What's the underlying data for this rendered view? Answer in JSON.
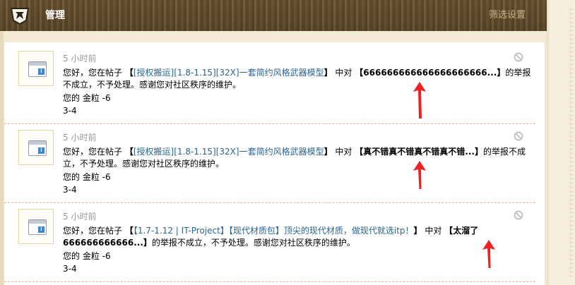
{
  "header": {
    "title": "管理",
    "filter_label": "筛选设置",
    "logo_icon": "pickaxe-shield-icon"
  },
  "notifications": [
    {
      "time": "5 小时前",
      "prefix": "您好，您在帖子",
      "bracket_open": "【",
      "thread_link": "[授权搬运][1.8-1.15][32X]一套简约风格武器模型",
      "bracket_close": "】",
      "mid": "中对",
      "reply_open": "【",
      "reply_quote": "666666666666666666666...",
      "reply_close": "】",
      "suffix": "的举报不成立，不予处理。感谢您对社区秩序的维护。",
      "reward_label": "您的 金粒",
      "reward_value": "-6",
      "score": "3-4"
    },
    {
      "time": "5 小时前",
      "prefix": "您好，您在帖子",
      "bracket_open": "【",
      "thread_link": "[授权搬运][1.8-1.15][32X]一套简约风格武器模型",
      "bracket_close": "】",
      "mid": "中对",
      "reply_open": "【",
      "reply_quote": "真不错真不错真不错真不错...",
      "reply_close": "】",
      "suffix": "的举报不成立，不予处理。感谢您对社区秩序的维护。",
      "reward_label": "您的 金粒",
      "reward_value": "-6",
      "score": "3-4"
    },
    {
      "time": "5 小时前",
      "prefix": "您好，您在帖子",
      "bracket_open": "【",
      "thread_link": "【1.7-1.12 | IT-Project】【现代材质包】顶尖的现代材质，做现代就选itp！",
      "bracket_close": "】",
      "mid": "中对",
      "reply_open": "【",
      "reply_quote": "太溜了666666666666...",
      "reply_close": "】",
      "suffix": "的举报不成立，不予处理。感谢您对社区秩序的维护。",
      "reward_label": "您的 金粒",
      "reward_value": "-6",
      "score": "3-4"
    }
  ],
  "colors": {
    "link": "#2a6496",
    "annotation_arrow": "#ee2222",
    "header_bg": "#65502f"
  }
}
